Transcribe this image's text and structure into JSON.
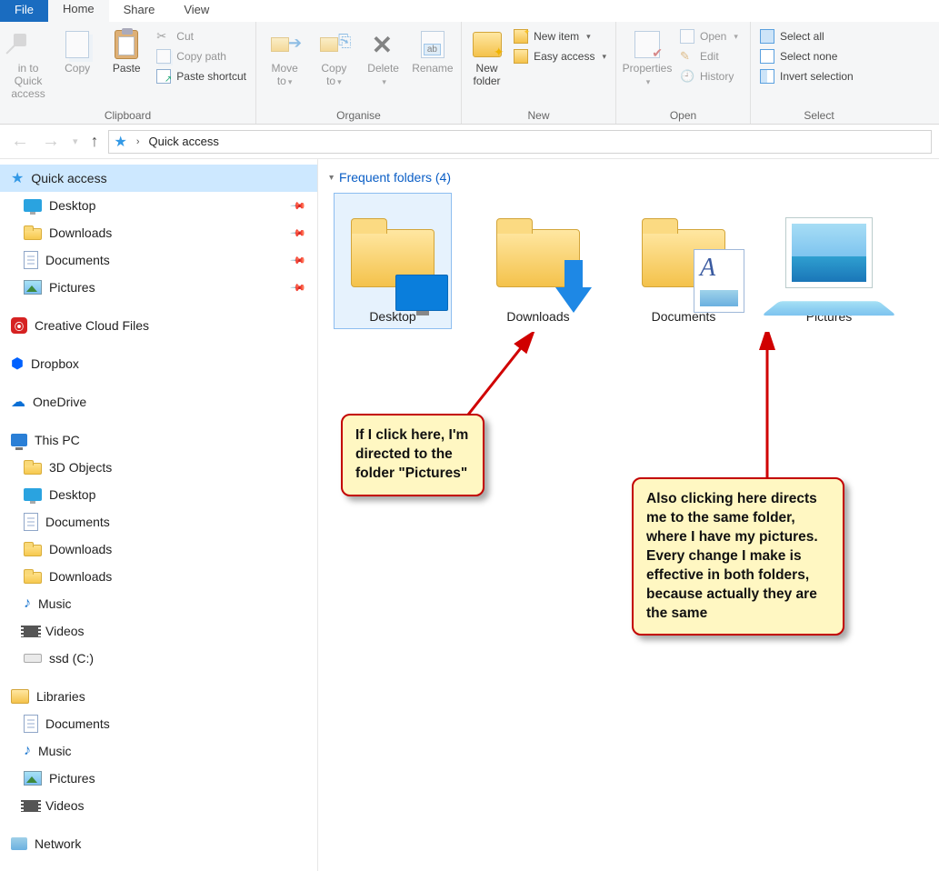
{
  "tabs": {
    "file": "File",
    "home": "Home",
    "share": "Share",
    "view": "View"
  },
  "ribbon": {
    "clipboard": {
      "label": "Clipboard",
      "pin": "in to Quick access",
      "copy": "Copy",
      "paste": "Paste",
      "cut": "Cut",
      "copypath": "Copy path",
      "pasteshortcut": "Paste shortcut"
    },
    "organise": {
      "label": "Organise",
      "moveto": "Move to",
      "copyto": "Copy to",
      "delete": "Delete",
      "rename": "Rename"
    },
    "new": {
      "label": "New",
      "newfolder": "New folder",
      "newitem": "New item",
      "easyaccess": "Easy access"
    },
    "open": {
      "label": "Open",
      "properties": "Properties",
      "open": "Open",
      "edit": "Edit",
      "history": "History"
    },
    "select": {
      "label": "Select",
      "all": "Select all",
      "none": "Select none",
      "invert": "Invert selection"
    }
  },
  "address": {
    "location": "Quick access"
  },
  "sidebar": {
    "quickaccess": "Quick access",
    "qa_items": [
      {
        "label": "Desktop",
        "pinned": true
      },
      {
        "label": "Downloads",
        "pinned": true
      },
      {
        "label": "Documents",
        "pinned": true
      },
      {
        "label": "Pictures",
        "pinned": true
      }
    ],
    "cc": "Creative Cloud Files",
    "dropbox": "Dropbox",
    "onedrive": "OneDrive",
    "thispc": "This PC",
    "pc_items": [
      "3D Objects",
      "Desktop",
      "Documents",
      "Downloads",
      "Downloads",
      "Music",
      "Videos",
      "ssd (C:)"
    ],
    "libraries": "Libraries",
    "lib_items": [
      "Documents",
      "Music",
      "Pictures",
      "Videos"
    ],
    "network": "Network"
  },
  "content": {
    "section": "Frequent folders (4)",
    "tiles": [
      "Desktop",
      "Downloads",
      "Documents",
      "Pictures"
    ]
  },
  "annotations": {
    "left": "If I click here, I'm directed to the folder \"Pictures\"",
    "right": "Also clicking here directs me to the same folder, where I have my pictures. Every change I make is effective in both folders, because actually they are the same"
  }
}
